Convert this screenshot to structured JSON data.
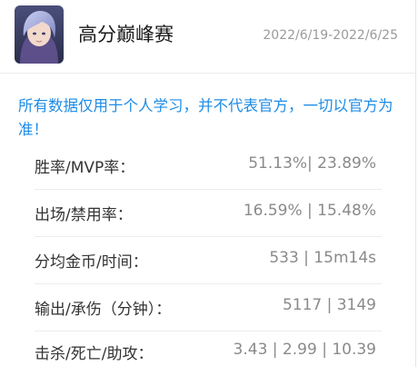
{
  "header": {
    "avatar_icon": "hero-portrait-icon",
    "title": "高分巅峰赛",
    "date_range": "2022/6/19-2022/6/25"
  },
  "notice": "所有数据仅用于个人学习，并不代表官方，一切以官方为准！",
  "accent_color": "#1e8ce6",
  "stats": [
    {
      "label": "胜率/MVP率：",
      "value": "51.13%| 23.89%"
    },
    {
      "label": "出场/禁用率：",
      "value": "16.59% | 15.48%"
    },
    {
      "label": "分均金币/时间：",
      "value": "533 | 15m14s"
    },
    {
      "label": "输出/承伤（分钟）：",
      "value": "5117 | 3149"
    },
    {
      "label": "击杀/死亡/助攻：",
      "value": "3.43 | 2.99 | 10.39"
    }
  ]
}
